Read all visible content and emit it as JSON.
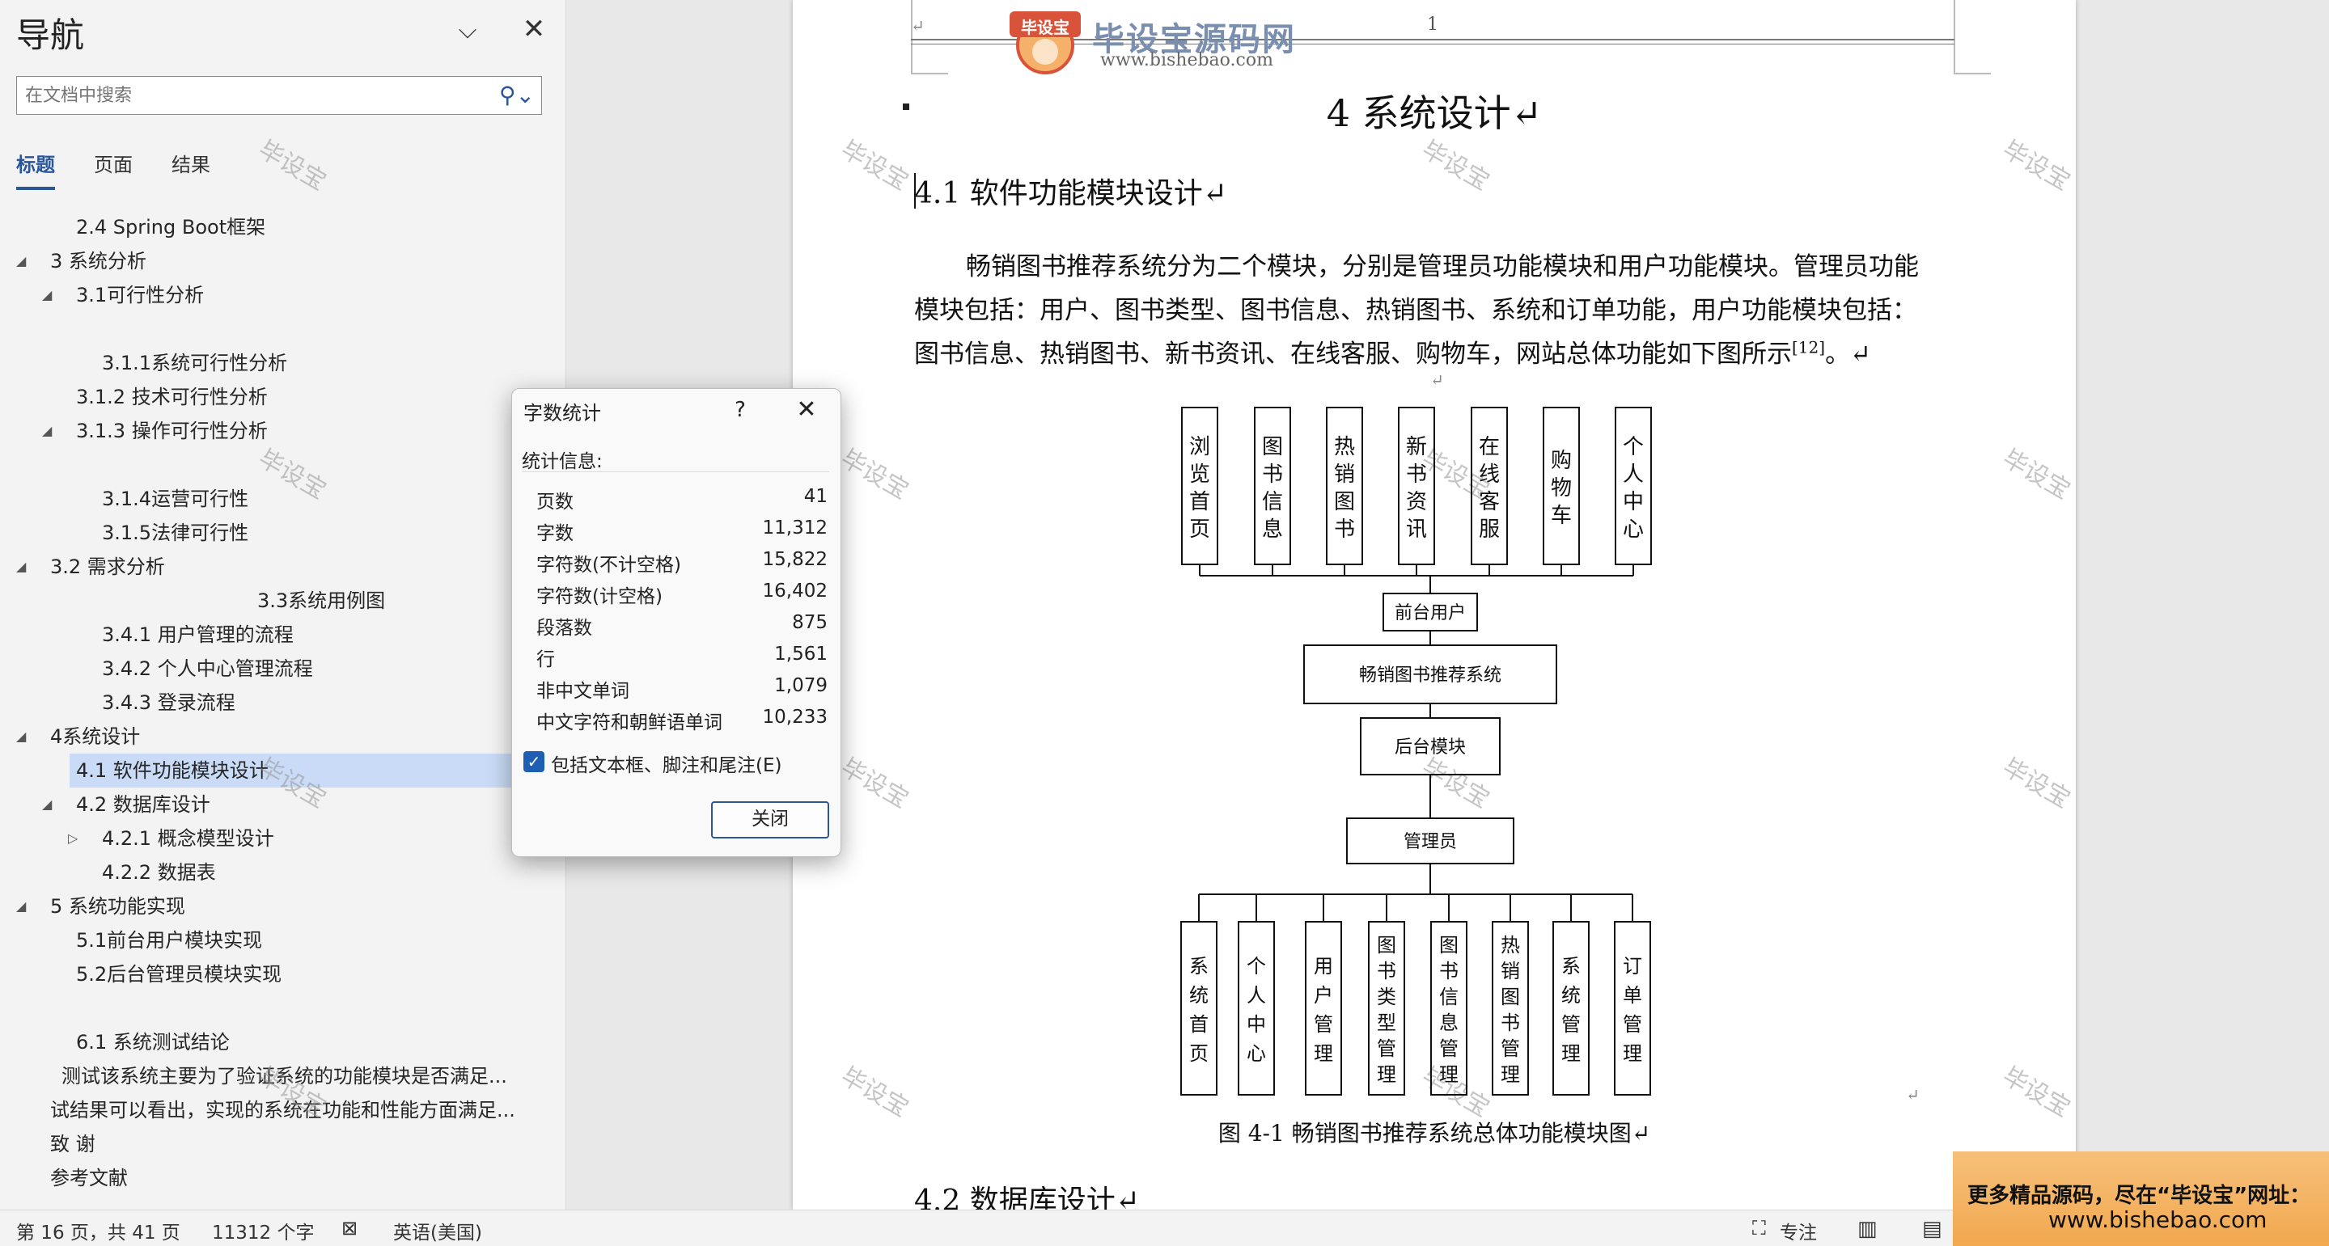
{
  "nav": {
    "title": "导航",
    "search_placeholder": "在文档中搜索",
    "tabs": [
      "标题",
      "页面",
      "结果"
    ],
    "tree": [
      {
        "label": "2.4 Spring Boot框架",
        "expandable": false
      },
      {
        "label": "3 系统分析",
        "expandable": true
      },
      {
        "label": "3.1可行性分析",
        "expandable": true
      },
      {
        "label": "3.1.1系统可行性分析",
        "expandable": false
      },
      {
        "label": "3.1.2 技术可行性分析",
        "expandable": false
      },
      {
        "label": "3.1.3 操作可行性分析",
        "expandable": true
      },
      {
        "label": "3.1.4运营可行性",
        "expandable": false
      },
      {
        "label": "3.1.5法律可行性",
        "expandable": false
      },
      {
        "label": "3.2 需求分析",
        "expandable": true
      },
      {
        "label": "3.3系统用例图",
        "expandable": false
      },
      {
        "label": "3.4.1 用户管理的流程",
        "expandable": false
      },
      {
        "label": "3.4.2 个人中心管理流程",
        "expandable": false
      },
      {
        "label": "3.4.3 登录流程",
        "expandable": false
      },
      {
        "label": "4系统设计",
        "expandable": true
      },
      {
        "label": "4.1 软件功能模块设计",
        "expandable": false
      },
      {
        "label": "4.2 数据库设计",
        "expandable": true
      },
      {
        "label": "4.2.1 概念模型设计",
        "expandable": true
      },
      {
        "label": "4.2.2 数据表",
        "expandable": false
      },
      {
        "label": "5 系统功能实现",
        "expandable": true
      },
      {
        "label": "5.1前台用户模块实现",
        "expandable": false
      },
      {
        "label": "5.2后台管理员模块实现",
        "expandable": false
      },
      {
        "label": "6.1 系统测试结论",
        "expandable": false
      },
      {
        "label": "测试该系统主要为了验证系统的功能模块是否满足...",
        "expandable": false
      },
      {
        "label": "试结果可以看出，实现的系统在功能和性能方面满足...",
        "expandable": false
      },
      {
        "label": "致  谢",
        "expandable": false
      },
      {
        "label": "参考文献",
        "expandable": false
      }
    ]
  },
  "doc": {
    "header_mark": "↵",
    "page_number": "1",
    "logo_badge": "毕设宝",
    "logo_name": "毕设宝源码网",
    "logo_url": "www.bishebao.com",
    "chapter_title": "4 系统设计↵",
    "section_title": "4.1  软件功能模块设计↵",
    "para_lines": [
      "畅销图书推荐系统分为二个模块，分别是管理员功能模块和用户功能模块。管理员功能",
      "模块包括：用户、图书类型、图书信息、热销图书、系统和订单功能，用户功能模块包括：",
      "图书信息、热销图书、新书资讯、在线客服、购物车，网站总体功能如下图所示"
    ],
    "para_ref": "[12]",
    "para_end": "。↵",
    "figure": {
      "top_modules": [
        "浏览首页",
        "图书信息",
        "热销图书",
        "新书资讯",
        "在线客服",
        "购物车",
        "个人中心"
      ],
      "front_user": "前台用户",
      "system": "畅销图书推荐系统",
      "backend": "后台模块",
      "admin": "管理员",
      "bottom_modules": [
        "系统首页",
        "个人中心",
        "用户管理",
        "图书类型管理",
        "图书信息管理",
        "热销图书管理",
        "系统管理",
        "订单管理"
      ]
    },
    "caption": "图 4-1 畅销图书推荐系统总体功能模块图↵",
    "next_section": "4.2  数据库设计↵",
    "watermark": "毕设宝"
  },
  "dialog": {
    "title": "字数统计",
    "help": "?",
    "section": "统计信息:",
    "rows": [
      {
        "label": "页数",
        "value": "41"
      },
      {
        "label": "字数",
        "value": "11,312"
      },
      {
        "label": "字符数(不计空格)",
        "value": "15,822"
      },
      {
        "label": "字符数(计空格)",
        "value": "16,402"
      },
      {
        "label": "段落数",
        "value": "875"
      },
      {
        "label": "行",
        "value": "1,561"
      },
      {
        "label": "非中文单词",
        "value": "1,079"
      },
      {
        "label": "中文字符和朝鲜语单词",
        "value": "10,233"
      }
    ],
    "checkbox_label": "包括文本框、脚注和尾注(E)",
    "checkbox_checked": true,
    "close_label": "关闭"
  },
  "status": {
    "page": "第 16 页，共 41 页",
    "words": "11312 个字",
    "language": "英语(美国)",
    "focus": "专注"
  },
  "ad": {
    "line1": "更多精品源码，尽在“毕设宝”网址：",
    "line2": "www.bishebao.com"
  }
}
